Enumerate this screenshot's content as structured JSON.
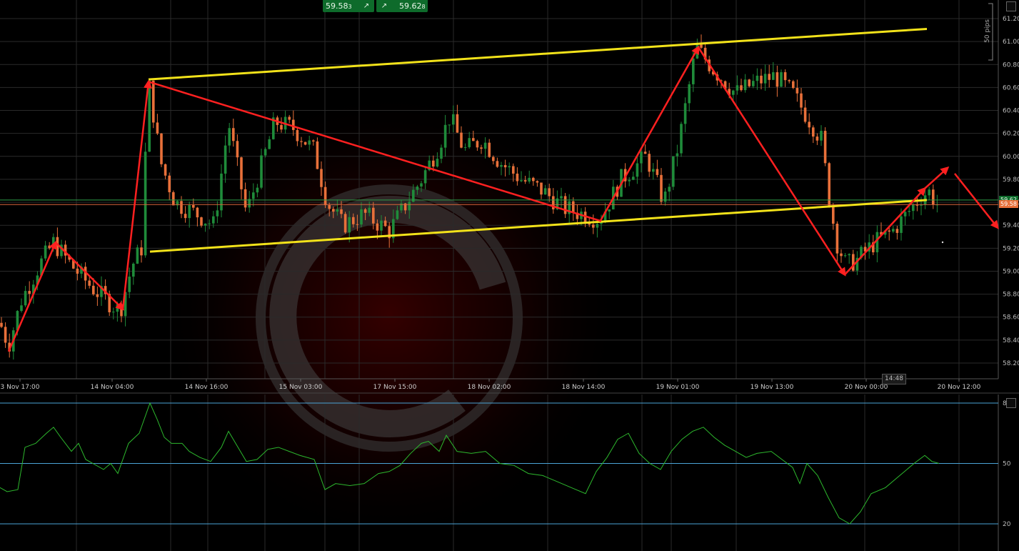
{
  "header": {
    "bid_price": "59.58",
    "bid_sub": "3",
    "ask_price": "59.62",
    "ask_sub": "8",
    "bid_icon": "buy-arrow-icon",
    "ask_icon": "buy-arrow-icon"
  },
  "price_tags": {
    "green_line": "59.62",
    "red_line": "59.58"
  },
  "scale_label": "50 pips",
  "crosshair_time": "14:48",
  "colors": {
    "background": "#000000",
    "grid": "#2a2a2a",
    "bull_candle": "#1f8b3a",
    "bear_candle": "#e8703a",
    "trendline": "#f2e21a",
    "arrows": "#ff2020",
    "oscillator": "#2db82d",
    "level_lines": "#4aa3d6"
  },
  "chart_data": [
    {
      "type": "candlestick",
      "x_axis": {
        "ticks": [
          "3 Nov 17:00",
          "14 Nov 04:00",
          "14 Nov 16:00",
          "15 Nov 03:00",
          "17 Nov 15:00",
          "18 Nov 02:00",
          "18 Nov 14:00",
          "19 Nov 01:00",
          "19 Nov 13:00",
          "20 Nov 00:00",
          "20 Nov 12:00"
        ]
      },
      "y_axis": {
        "range": [
          58.1,
          61.3
        ],
        "ticks": [
          "61.20",
          "61.00",
          "60.80",
          "60.60",
          "60.40",
          "60.20",
          "60.00",
          "59.80",
          "59.60",
          "59.40",
          "59.20",
          "59.00",
          "58.80",
          "58.60",
          "58.40",
          "58.20"
        ]
      },
      "current_bid": 59.58,
      "current_ask": 59.62,
      "price_path": [
        [
          0,
          58.55
        ],
        [
          12,
          58.35
        ],
        [
          30,
          58.75
        ],
        [
          55,
          59.05
        ],
        [
          75,
          59.25
        ],
        [
          100,
          59.05
        ],
        [
          130,
          58.85
        ],
        [
          168,
          58.65
        ],
        [
          185,
          59.05
        ],
        [
          198,
          59.2
        ],
        [
          208,
          60.65
        ],
        [
          225,
          59.95
        ],
        [
          245,
          59.6
        ],
        [
          275,
          59.5
        ],
        [
          300,
          59.4
        ],
        [
          320,
          60.3
        ],
        [
          345,
          59.5
        ],
        [
          365,
          59.9
        ],
        [
          385,
          60.3
        ],
        [
          410,
          60.25
        ],
        [
          440,
          60.05
        ],
        [
          458,
          59.6
        ],
        [
          480,
          59.4
        ],
        [
          510,
          59.5
        ],
        [
          545,
          59.35
        ],
        [
          565,
          59.55
        ],
        [
          590,
          59.8
        ],
        [
          615,
          60.1
        ],
        [
          630,
          60.35
        ],
        [
          650,
          60.05
        ],
        [
          675,
          60.15
        ],
        [
          700,
          59.95
        ],
        [
          730,
          59.8
        ],
        [
          760,
          59.7
        ],
        [
          790,
          59.55
        ],
        [
          815,
          59.5
        ],
        [
          840,
          59.45
        ],
        [
          870,
          59.8
        ],
        [
          905,
          60.0
        ],
        [
          930,
          59.6
        ],
        [
          950,
          60.1
        ],
        [
          975,
          60.95
        ],
        [
          1000,
          60.75
        ],
        [
          1030,
          60.55
        ],
        [
          1060,
          60.65
        ],
        [
          1085,
          60.7
        ],
        [
          1110,
          60.55
        ],
        [
          1135,
          60.3
        ],
        [
          1150,
          60.15
        ],
        [
          1162,
          59.6
        ],
        [
          1172,
          59.25
        ],
        [
          1185,
          59.05
        ],
        [
          1200,
          59.1
        ],
        [
          1225,
          59.25
        ],
        [
          1250,
          59.35
        ],
        [
          1270,
          59.5
        ],
        [
          1290,
          59.65
        ],
        [
          1300,
          59.7
        ],
        [
          1313,
          59.58
        ]
      ],
      "trendlines": {
        "upper_channel": [
          [
            208,
            60.67
          ],
          [
            1298,
            61.11
          ]
        ],
        "lower_channel": [
          [
            210,
            59.17
          ],
          [
            1298,
            59.62
          ]
        ],
        "descending": [
          [
            208,
            60.65
          ],
          [
            840,
            59.44
          ]
        ]
      },
      "wave_arrows": [
        [
          [
            12,
            58.3
          ],
          [
            78,
            59.25
          ],
          [
            172,
            58.67
          ],
          [
            208,
            60.65
          ]
        ],
        [
          [
            840,
            59.43
          ],
          [
            978,
            60.95
          ],
          [
            1183,
            58.97
          ],
          [
            1295,
            59.72
          ],
          [
            1327,
            59.9
          ]
        ],
        [
          [
            1337,
            59.85
          ],
          [
            1397,
            59.38
          ]
        ]
      ],
      "horizontal_levels": {
        "green": 59.62,
        "red": 59.58
      }
    },
    {
      "type": "line",
      "name": "oscillator",
      "y_axis": {
        "range": [
          15,
          85
        ],
        "ticks": [
          "80",
          "50",
          "20"
        ],
        "levels": [
          80,
          50,
          20
        ]
      },
      "values": [
        [
          0,
          38
        ],
        [
          10,
          36
        ],
        [
          25,
          37
        ],
        [
          35,
          58
        ],
        [
          50,
          60
        ],
        [
          65,
          65
        ],
        [
          75,
          68
        ],
        [
          85,
          63
        ],
        [
          100,
          56
        ],
        [
          110,
          60
        ],
        [
          120,
          52
        ],
        [
          130,
          50
        ],
        [
          145,
          47
        ],
        [
          155,
          50
        ],
        [
          165,
          45
        ],
        [
          180,
          60
        ],
        [
          195,
          65
        ],
        [
          210,
          80
        ],
        [
          220,
          72
        ],
        [
          230,
          63
        ],
        [
          240,
          60
        ],
        [
          255,
          60
        ],
        [
          265,
          56
        ],
        [
          280,
          53
        ],
        [
          295,
          51
        ],
        [
          310,
          58
        ],
        [
          320,
          66
        ],
        [
          330,
          60
        ],
        [
          345,
          51
        ],
        [
          360,
          52
        ],
        [
          375,
          57
        ],
        [
          390,
          58
        ],
        [
          405,
          56
        ],
        [
          420,
          54
        ],
        [
          440,
          52
        ],
        [
          455,
          37
        ],
        [
          470,
          40
        ],
        [
          490,
          39
        ],
        [
          510,
          40
        ],
        [
          530,
          45
        ],
        [
          545,
          46
        ],
        [
          560,
          49
        ],
        [
          575,
          55
        ],
        [
          590,
          60
        ],
        [
          600,
          61
        ],
        [
          615,
          56
        ],
        [
          625,
          64
        ],
        [
          640,
          56
        ],
        [
          660,
          55
        ],
        [
          680,
          56
        ],
        [
          700,
          50
        ],
        [
          720,
          49
        ],
        [
          740,
          45
        ],
        [
          760,
          44
        ],
        [
          780,
          41
        ],
        [
          800,
          38
        ],
        [
          820,
          35
        ],
        [
          835,
          46
        ],
        [
          850,
          53
        ],
        [
          865,
          62
        ],
        [
          880,
          65
        ],
        [
          895,
          55
        ],
        [
          910,
          50
        ],
        [
          925,
          47
        ],
        [
          940,
          56
        ],
        [
          955,
          62
        ],
        [
          970,
          66
        ],
        [
          985,
          68
        ],
        [
          1000,
          63
        ],
        [
          1015,
          59
        ],
        [
          1030,
          56
        ],
        [
          1045,
          53
        ],
        [
          1060,
          55
        ],
        [
          1080,
          56
        ],
        [
          1095,
          52
        ],
        [
          1110,
          48
        ],
        [
          1120,
          40
        ],
        [
          1130,
          50
        ],
        [
          1145,
          44
        ],
        [
          1160,
          33
        ],
        [
          1175,
          23
        ],
        [
          1190,
          20
        ],
        [
          1205,
          26
        ],
        [
          1220,
          35
        ],
        [
          1240,
          38
        ],
        [
          1260,
          44
        ],
        [
          1280,
          50
        ],
        [
          1295,
          54
        ],
        [
          1305,
          51
        ],
        [
          1315,
          50
        ]
      ]
    }
  ]
}
